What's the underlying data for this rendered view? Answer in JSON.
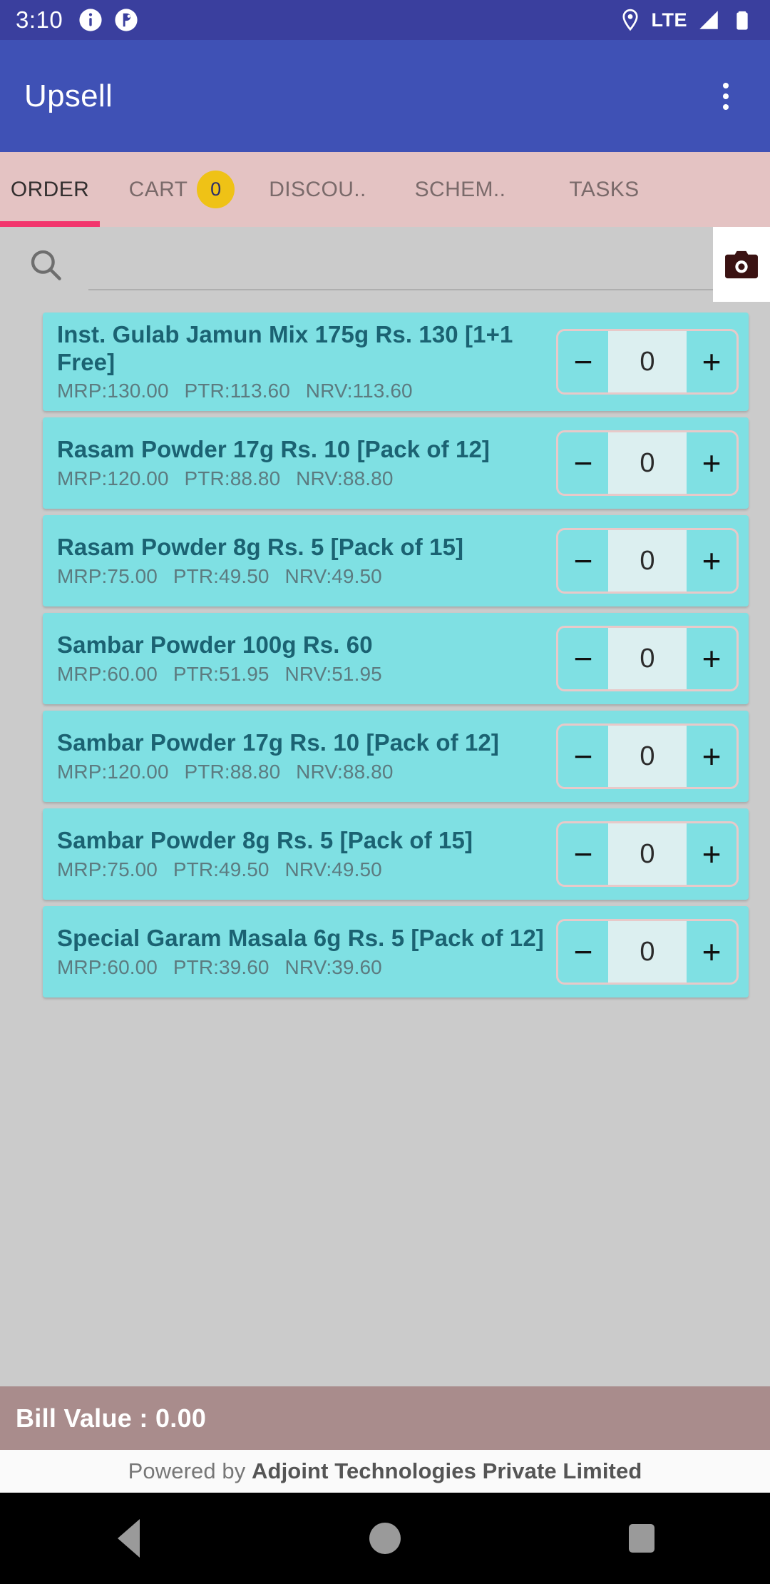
{
  "status_bar": {
    "time": "3:10",
    "network_label": "LTE",
    "icons": [
      "info-icon",
      "app-notification-icon",
      "location-pin-icon",
      "signal-icon",
      "battery-icon"
    ]
  },
  "app_bar": {
    "title": "Upsell",
    "overflow_icon": "kebab-menu-icon"
  },
  "tabs": [
    {
      "label": "ORDER",
      "active": true,
      "badge": null
    },
    {
      "label": "CART",
      "active": false,
      "badge": "0"
    },
    {
      "label": "DISCOU..",
      "active": false,
      "badge": null
    },
    {
      "label": "SCHEM..",
      "active": false,
      "badge": null
    },
    {
      "label": "TASKS",
      "active": false,
      "badge": null
    }
  ],
  "search": {
    "value": "",
    "placeholder": "",
    "icon": "search-icon",
    "camera_icon": "camera-icon"
  },
  "products": [
    {
      "name": "Inst. Gulab Jamun Mix 175g Rs. 130 [1+1 Free]",
      "mrp": "MRP:130.00",
      "ptr": "PTR:113.60",
      "nrv": "NRV:113.60",
      "qty": "0",
      "minus": "−",
      "plus": "+"
    },
    {
      "name": "Rasam Powder 17g Rs. 10 [Pack of 12]",
      "mrp": "MRP:120.00",
      "ptr": "PTR:88.80",
      "nrv": "NRV:88.80",
      "qty": "0",
      "minus": "−",
      "plus": "+"
    },
    {
      "name": "Rasam Powder 8g Rs. 5 [Pack of 15]",
      "mrp": "MRP:75.00",
      "ptr": "PTR:49.50",
      "nrv": "NRV:49.50",
      "qty": "0",
      "minus": "−",
      "plus": "+"
    },
    {
      "name": "Sambar Powder 100g Rs. 60",
      "mrp": "MRP:60.00",
      "ptr": "PTR:51.95",
      "nrv": "NRV:51.95",
      "qty": "0",
      "minus": "−",
      "plus": "+"
    },
    {
      "name": "Sambar Powder 17g Rs. 10 [Pack of 12]",
      "mrp": "MRP:120.00",
      "ptr": "PTR:88.80",
      "nrv": "NRV:88.80",
      "qty": "0",
      "minus": "−",
      "plus": "+"
    },
    {
      "name": "Sambar Powder 8g Rs. 5 [Pack of 15]",
      "mrp": "MRP:75.00",
      "ptr": "PTR:49.50",
      "nrv": "NRV:49.50",
      "qty": "0",
      "minus": "−",
      "plus": "+"
    },
    {
      "name": "Special Garam Masala 6g Rs. 5 [Pack of 12]",
      "mrp": "MRP:60.00",
      "ptr": "PTR:39.60",
      "nrv": "NRV:39.60",
      "qty": "0",
      "minus": "−",
      "plus": "+"
    }
  ],
  "bill": {
    "label": "Bill Value : 0.00"
  },
  "footer": {
    "prefix": "Powered by ",
    "company": "Adjoint Technologies Private Limited"
  },
  "nav_bar": {
    "back": "back-icon",
    "home": "home-icon",
    "recents": "recents-icon"
  },
  "colors": {
    "status_bar": "#3A3F9E",
    "app_bar": "#3F51B5",
    "tab_bar": "#E4C3C3",
    "tab_indicator": "#F2356D",
    "cart_badge": "#EFC216",
    "card": "#7FE0E3",
    "card_title": "#1B6272",
    "bill_bar": "#A98C8C",
    "list_background": "#CBCBCB"
  }
}
